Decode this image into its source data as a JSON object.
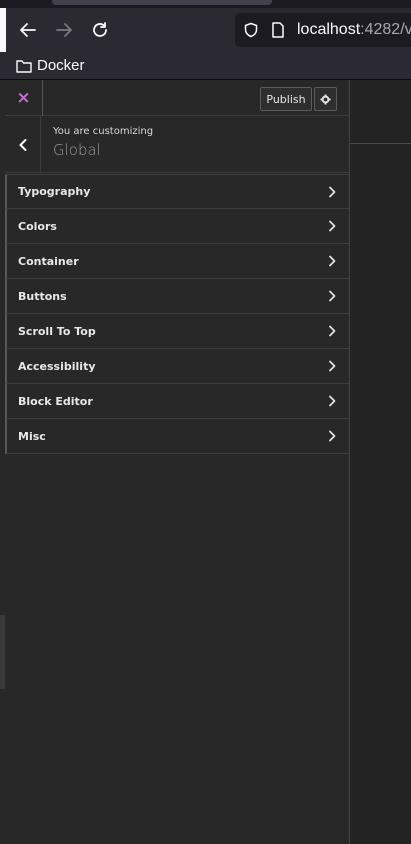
{
  "browser": {
    "url_host": "localhost",
    "url_port": ":4282/v",
    "bookmark_label": "Docker"
  },
  "customizer": {
    "close_symbol": "×",
    "publish_label": "Publish",
    "customizing_label": "You are customizing",
    "customizing_title": "Global",
    "sections": [
      {
        "label": "Typography"
      },
      {
        "label": "Colors"
      },
      {
        "label": "Container"
      },
      {
        "label": "Buttons"
      },
      {
        "label": "Scroll To Top"
      },
      {
        "label": "Accessibility"
      },
      {
        "label": "Block Editor"
      },
      {
        "label": "Misc"
      }
    ]
  },
  "colors": {
    "accent_close": "#c66ad9",
    "panel_bg": "#282828",
    "chrome_bg": "#2b2a33"
  },
  "icons": [
    "back-arrow-icon",
    "forward-arrow-icon",
    "reload-icon",
    "shield-icon",
    "page-icon",
    "folder-icon",
    "close-icon",
    "gear-icon",
    "chevron-left-icon",
    "chevron-right-icon"
  ]
}
